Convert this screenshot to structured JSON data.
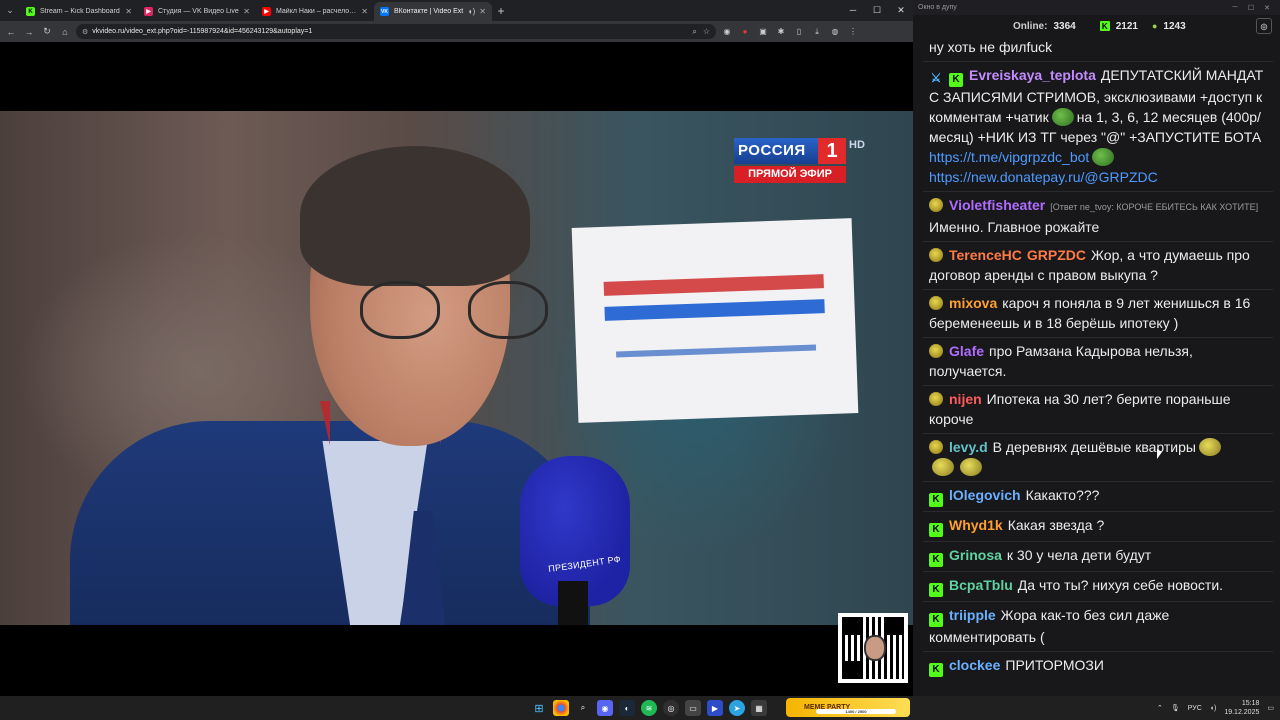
{
  "browser": {
    "tabs": [
      {
        "title": "Stream – Kick Dashboard",
        "favicon_color": "#53fc18",
        "favicon_letter": "K"
      },
      {
        "title": "Студия — VK Видео Live",
        "favicon_color": "#e0245e",
        "favicon_letter": "▶"
      },
      {
        "title": "Майкл Наки – расчеловечива…",
        "favicon_color": "#ff0000",
        "favicon_letter": "▶"
      },
      {
        "title": "ВКонтакте | Video Ext",
        "favicon_color": "#0077ff",
        "favicon_letter": "VK"
      }
    ],
    "url": "vkvideo.ru/video_ext.php?oid=-115987924&id=456243129&autoplay=1"
  },
  "video": {
    "channel_logo": {
      "name": "РОССИЯ",
      "number": "1",
      "hd": "HD",
      "live": "ПРЯМОЙ ЭФИР"
    },
    "mic_label": "ПРЕЗИДЕНТ РФ"
  },
  "chat": {
    "window_title": "Окно в дупу",
    "online_label": "Online:",
    "online_count": "3364",
    "kick_count": "2121",
    "other_count": "1243",
    "messages": [
      {
        "user": "",
        "color": "#ececec",
        "badges": [],
        "text": "ну хоть не филfuck"
      },
      {
        "user": "Evreiskaya_teplota",
        "color": "#c28cff",
        "badges": [
          "sword",
          "kick"
        ],
        "text": "ДЕПУТАТСКИЙ МАНДАТ С ЗАПИСЯМИ СТРИМОВ, эксклюзивами +доступ к комментам +чатик",
        "text2": "на 1, 3, 6, 12 месяцев (400р/месяц) +НИК ИЗ ТГ через \"@\" +ЗАПУСТИТЕ БОТА",
        "link1": "https://t.me/vipgrpzdc_bot",
        "link2": "https://new.donatepay.ru/@GRPZDC"
      },
      {
        "user": "Violetfisheater",
        "color": "#b06cff",
        "badges": [
          "pepe"
        ],
        "reply": "[Ответ ne_tvoy: КОРОЧЕ ЕБИТЕСЬ КАК ХОТИТЕ]",
        "text": "Именно. Главное рожайте"
      },
      {
        "user": "TerenceHC",
        "color": "#ff7a45",
        "badges": [
          "pepe"
        ],
        "mention": "GRPZDC",
        "text": "Жор, а что думаешь про договор аренды с правом выкупа ?"
      },
      {
        "user": "mixova",
        "color": "#ff9f2e",
        "badges": [
          "pepe"
        ],
        "text": "кароч я поняла в 9 лет женишься в 16 беременеешь и в 18 берёшь ипотеку )"
      },
      {
        "user": "Glafe",
        "color": "#b06cff",
        "badges": [
          "pepe"
        ],
        "text": "про Рамзана Кадырова нельзя, получается."
      },
      {
        "user": "nijen",
        "color": "#ff5b5b",
        "badges": [
          "pepe"
        ],
        "text": "Ипотека на 30 лет? берите пораньше короче"
      },
      {
        "user": "levy.d",
        "color": "#63c1c8",
        "badges": [
          "pepe"
        ],
        "text": "В деревнях дешёвые квартиры"
      },
      {
        "user": "lOlegovich",
        "color": "#6ab0ff",
        "badges": [
          "kick"
        ],
        "text": "Какакто???"
      },
      {
        "user": "Whyd1k",
        "color": "#ff9f2e",
        "badges": [
          "kick"
        ],
        "text": "Какая звезда ?"
      },
      {
        "user": "Grinosa",
        "color": "#5fd2a0",
        "badges": [
          "kick"
        ],
        "text": "к 30 у чела дети будут"
      },
      {
        "user": "BcpaTblu",
        "color": "#5fd2a0",
        "badges": [
          "kick"
        ],
        "text": "Да что ты? нихуя себе новости."
      },
      {
        "user": "triipple",
        "color": "#6ab0ff",
        "badges": [
          "kick"
        ],
        "text": "Жора как-то без сил даже комментировать ("
      },
      {
        "user": "clockee",
        "color": "#6ab0ff",
        "badges": [
          "kick"
        ],
        "text": "ПРИТОРМОЗИ"
      }
    ]
  },
  "taskbar": {
    "widget_label": "MEME PARTY",
    "widget_progress": "1400 / 2500",
    "lang": "РУС",
    "time": "15:18",
    "date": "19.12.2025"
  },
  "colors": {
    "kick_green": "#53fc18",
    "chat_bg": "#18181b",
    "link": "#4e9bff"
  }
}
